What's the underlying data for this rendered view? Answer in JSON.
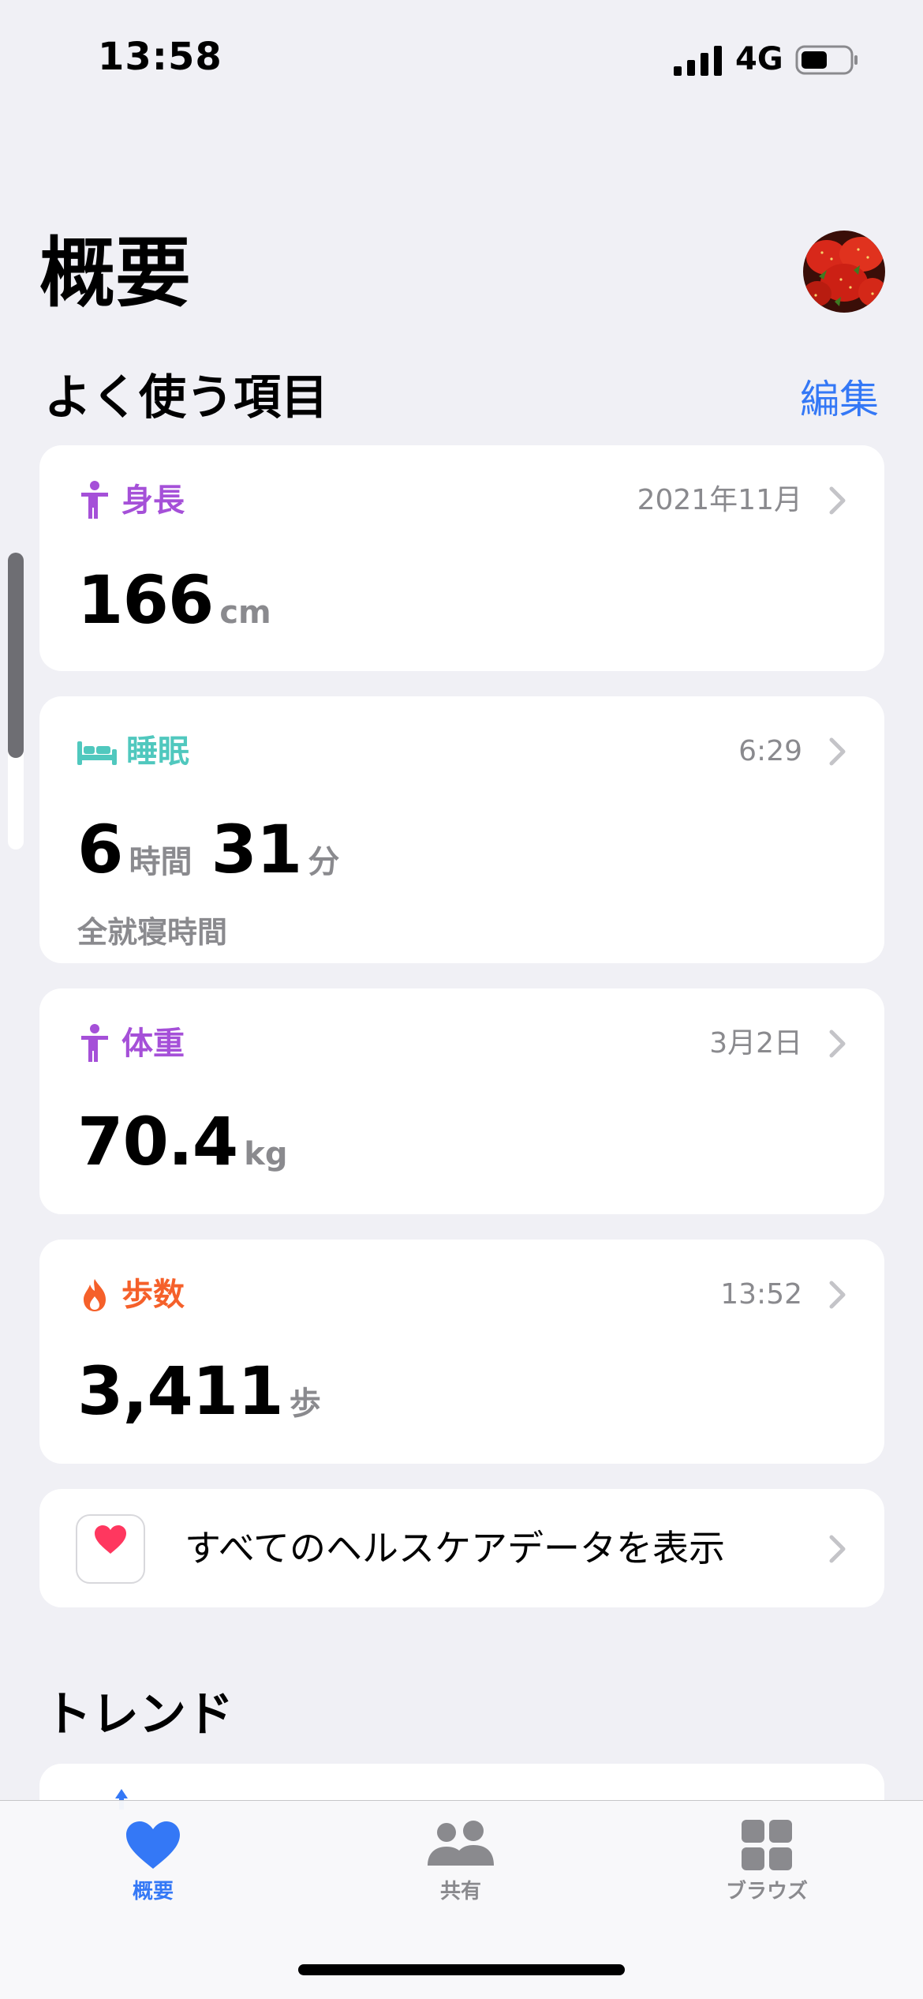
{
  "status_bar": {
    "time": "13:58",
    "network": "4G"
  },
  "header": {
    "title": "概要",
    "avatar_icon": "strawberry-avatar"
  },
  "favorites": {
    "title": "よく使う項目",
    "edit_label": "編集",
    "cards": [
      {
        "title": "身長",
        "date": "2021年11月",
        "icon": "figure-icon",
        "color": "#a550d8",
        "value": "166",
        "unit": "cm"
      },
      {
        "title": "睡眠",
        "date": "6:29",
        "icon": "bed-icon",
        "color": "#50c8be",
        "value_hours": "6",
        "unit_hours": "時間",
        "value_minutes": "31",
        "unit_minutes": "分",
        "sub_label": "全就寝時間"
      },
      {
        "title": "体重",
        "date": "3月2日",
        "icon": "figure-icon",
        "color": "#a550d8",
        "value": "70.4",
        "unit": "kg"
      },
      {
        "title": "歩数",
        "date": "13:52",
        "icon": "flame-icon",
        "color": "#f5602a",
        "value": "3,411",
        "unit": "歩"
      }
    ],
    "all_data_label": "すべてのヘルスケアデータを表示"
  },
  "trends": {
    "title": "トレンド"
  },
  "tab_bar": {
    "active_color": "#3478f6",
    "inactive_color": "#8a8a8e",
    "tabs": [
      {
        "label": "概要",
        "icon": "heart-icon",
        "active": true
      },
      {
        "label": "共有",
        "icon": "people-icon",
        "active": false
      },
      {
        "label": "ブラウズ",
        "icon": "grid-icon",
        "active": false
      }
    ]
  }
}
